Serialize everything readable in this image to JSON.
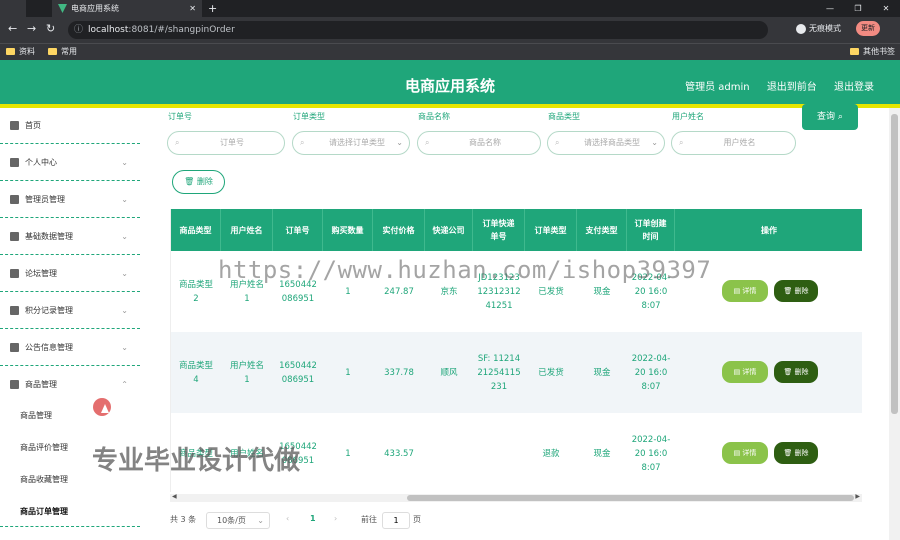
{
  "browser": {
    "inactive_tab_label": "",
    "active_tab_label": "电商应用系统",
    "new_tab": "+",
    "window_controls": [
      "—",
      "❐",
      "✕"
    ],
    "url_host": "localhost",
    "url_rest": ":8081/#/shangpinOrder",
    "profile_label": "无痕模式",
    "update_button": "更新",
    "bookmarks": [
      "资料",
      "常用"
    ],
    "other_bookmarks": "其他书签"
  },
  "header": {
    "title": "电商应用系统",
    "admin_label": "管理员 admin",
    "back_frontend": "退出到前台",
    "logout": "退出登录"
  },
  "sidebar": {
    "items": [
      {
        "label": "首页",
        "icon": "home-icon",
        "has_chevron": false
      },
      {
        "label": "个人中心",
        "icon": "user-icon",
        "has_chevron": true
      },
      {
        "label": "管理员管理",
        "icon": "sliders-icon",
        "has_chevron": true
      },
      {
        "label": "基础数据管理",
        "icon": "data-icon",
        "has_chevron": true
      },
      {
        "label": "论坛管理",
        "icon": "chart-icon",
        "has_chevron": true
      },
      {
        "label": "积分记录管理",
        "icon": "clipboard-icon",
        "has_chevron": true
      },
      {
        "label": "公告信息管理",
        "icon": "pin-icon",
        "has_chevron": true
      },
      {
        "label": "商品管理",
        "icon": "mail-icon",
        "has_chevron": true
      }
    ],
    "sub_items": [
      "商品管理",
      "商品评价管理",
      "商品收藏管理",
      "商品订单管理"
    ],
    "chevron": "⌄",
    "chevron_up": "⌃"
  },
  "filters": {
    "labels": [
      "订单号",
      "订单类型",
      "商品名称",
      "商品类型",
      "用户姓名"
    ],
    "placeholders": [
      "订单号",
      "请选择订单类型",
      "商品名称",
      "请选择商品类型",
      "用户姓名"
    ],
    "query_button": "查询",
    "delete_button": "删除"
  },
  "table": {
    "headers": [
      "商品类型",
      "用户姓名",
      "订单号",
      "购买数量",
      "实付价格",
      "快递公司",
      "订单快递单号",
      "订单类型",
      "支付类型",
      "订单创建时间",
      "操作"
    ],
    "rows": [
      {
        "type": "商品类型2",
        "user": "用户姓名1",
        "order_no": "1650442086951",
        "qty": "1",
        "price": "247.87",
        "courier": "京东",
        "tracking": "JD1231231231231241251",
        "order_type": "已发货",
        "pay": "现金",
        "created": "2022-04-20 16:08:07"
      },
      {
        "type": "商品类型4",
        "user": "用户姓名1",
        "order_no": "1650442086951",
        "qty": "1",
        "price": "337.78",
        "courier": "顺风",
        "tracking": "SF: 1121421254115231",
        "order_type": "已发货",
        "pay": "现金",
        "created": "2022-04-20 16:08:07"
      },
      {
        "type": "商品类型",
        "user": "用户姓名",
        "order_no": "1650442086951",
        "qty": "1",
        "price": "433.57",
        "courier": "",
        "tracking": "",
        "order_type": "退款",
        "pay": "现金",
        "created": "2022-04-20 16:08:07"
      }
    ],
    "detail_button": "详情",
    "row_delete_button": "删除"
  },
  "pager": {
    "total": "共 3 条",
    "page_size": "10条/页",
    "prev": "‹",
    "current": "1",
    "next": "›",
    "goto_label": "前往",
    "goto_value": "1",
    "page_suffix": "页"
  },
  "watermarks": {
    "url": "https://www.huzhan.com/ishop39397",
    "caption": "专业毕业设计代做"
  },
  "colors": {
    "brand": "#1fa67a",
    "header_accent": "#e6e600",
    "detail_button": "#8bc34a",
    "delete_button": "#2e5e12"
  }
}
